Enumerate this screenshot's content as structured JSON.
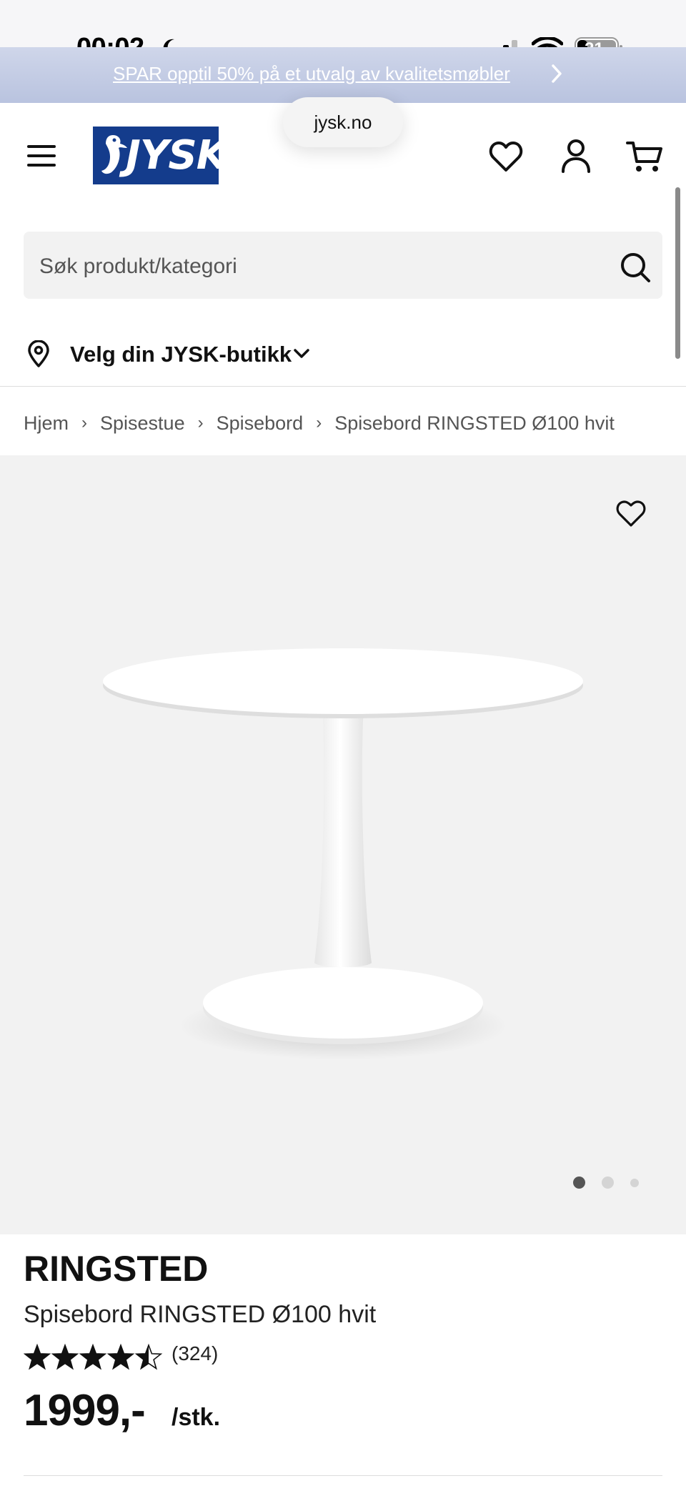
{
  "status_bar": {
    "time": "00:02",
    "battery_level": "21"
  },
  "promo_banner": {
    "text": "SPAR opptil 50% på et utvalg av kvalitetsmøbler"
  },
  "browser": {
    "url": "jysk.no"
  },
  "header": {
    "logo_text": "JYSK",
    "icons": [
      "menu-icon",
      "heart-icon",
      "user-icon",
      "cart-icon"
    ]
  },
  "search": {
    "placeholder": "Søk produkt/kategori"
  },
  "store_selector": {
    "label": "Velg din JYSK-butikk"
  },
  "breadcrumb": {
    "items": [
      "Hjem",
      "Spisestue",
      "Spisebord",
      "Spisebord RINGSTED Ø100 hvit"
    ]
  },
  "gallery": {
    "image_count": 3,
    "active_index": 0
  },
  "product": {
    "brand": "RINGSTED",
    "name": "Spisebord RINGSTED Ø100 hvit",
    "rating": 4.5,
    "rating_max": 5,
    "review_count": "(324)",
    "price": "1999,-",
    "unit": "/stk."
  },
  "colors": {
    "brand_blue": "#143c8c",
    "promo_bg": "#c3cce4",
    "image_bg": "#f2f2f2"
  }
}
